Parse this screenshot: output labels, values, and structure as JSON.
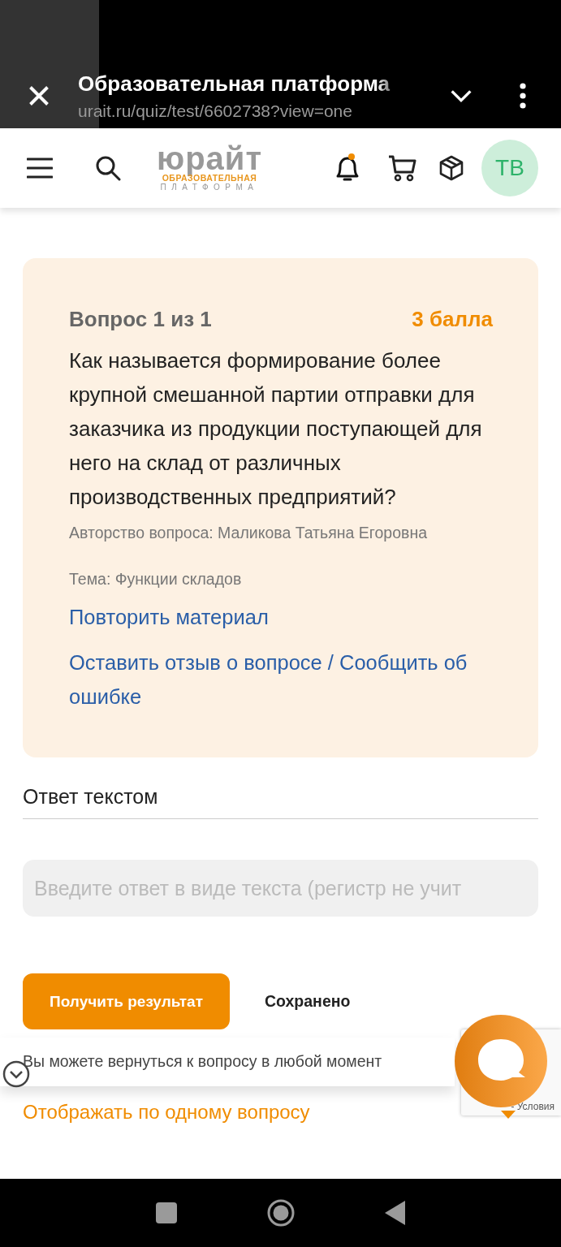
{
  "browser": {
    "title": "Образовательная платформа",
    "url": "urait.ru/quiz/test/6602738?view=one"
  },
  "header": {
    "logo_word": "юрайт",
    "logo_line1": "ОБРАЗОВАТЕЛЬНАЯ",
    "logo_line2": "ПЛАТФОРМА",
    "avatar": "ТВ"
  },
  "question": {
    "counter": "Вопрос 1 из 1",
    "points": "3 балла",
    "text": "Как называется формирование более крупной смешанной партии отправки для заказчика из продукции поступающей для него на склад от различных производственных предприятий?",
    "author": "Авторство вопроса: Маликова Татьяна Егоровна",
    "topic": "Тема: Функции складов",
    "links": [
      "Повторить материал",
      "Оставить отзыв о вопросе / Сообщить об ошибке"
    ]
  },
  "answer": {
    "label": "Ответ текстом",
    "placeholder": "Введите ответ в виде текста (регистр не учит"
  },
  "submit_button": "Получить результат",
  "status": "Сохранено",
  "hint": "Вы можете вернуться к вопросу в любой момент",
  "recaptcha_text": "- Условия",
  "display_mode": "Отображать по одному вопросу"
}
